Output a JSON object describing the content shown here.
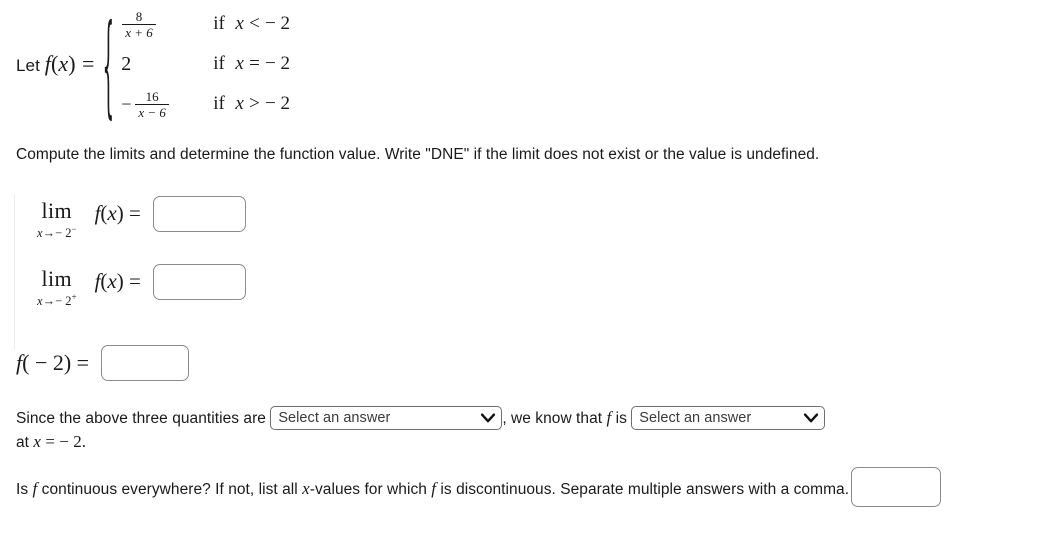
{
  "problem": {
    "definition": {
      "lead": "Let ",
      "function_name": "f",
      "function_arg": "x",
      "equals": "=",
      "cases": [
        {
          "type": "fraction",
          "numerator": "8",
          "denominator": "x + 6",
          "sign": "",
          "condition_var": "x",
          "condition_rel": "<",
          "condition_val": "− 2",
          "condition_kw": "if"
        },
        {
          "type": "value",
          "value": "2",
          "sign": "",
          "condition_var": "x",
          "condition_rel": "=",
          "condition_val": "− 2",
          "condition_kw": "if"
        },
        {
          "type": "fraction",
          "numerator": "16",
          "denominator": "x − 6",
          "sign": "−",
          "condition_var": "x",
          "condition_rel": ">",
          "condition_val": "− 2",
          "condition_kw": "if"
        }
      ]
    },
    "instructions": "Compute the limits and determine the function value. Write \"DNE\" if the limit does not exist or the value is undefined.",
    "limits": [
      {
        "operator": "lim",
        "subscript_var": "x",
        "subscript_arrow": "→",
        "subscript_value": "− 2",
        "subscript_side": "−",
        "body": "f(x) =",
        "input_value": "",
        "input_placeholder": ""
      },
      {
        "operator": "lim",
        "subscript_var": "x",
        "subscript_arrow": "→",
        "subscript_value": "− 2",
        "subscript_side": "+",
        "body": "f(x) =",
        "input_value": "",
        "input_placeholder": ""
      }
    ],
    "function_value": {
      "label_fn": "f",
      "label_args": "( − 2) =",
      "input_value": "",
      "input_placeholder": ""
    },
    "since_statement": {
      "part1": "Since the above three quantities are",
      "part2": ", we know that",
      "part3_fn": "f",
      "part4": "is",
      "part5_prefix": "at",
      "part5_var": "x",
      "part5_rest": "= − 2."
    },
    "selects": [
      {
        "name": "quantities-relation",
        "selected": "Select an answer",
        "icon": "chevron-down-icon"
      },
      {
        "name": "continuity-relation",
        "selected": "Select an answer",
        "icon": "chevron-down-icon"
      }
    ],
    "continuity_question": {
      "part1": "Is",
      "fn": "f",
      "part2": "continuous everywhere? If not, list all",
      "var": "x",
      "part3": "-values for which",
      "fn2": "f",
      "part4": "is discontinuous. Separate multiple answers",
      "part5": "with a comma.",
      "input_value": "",
      "input_placeholder": ""
    }
  },
  "colors": {
    "background": "#ffffff",
    "text": "#1a1a1a",
    "input_border": "#8b8b8b",
    "select_border": "#6e6e6e",
    "select_text": "#3a3a3a",
    "indent_rule": "#ececec"
  }
}
